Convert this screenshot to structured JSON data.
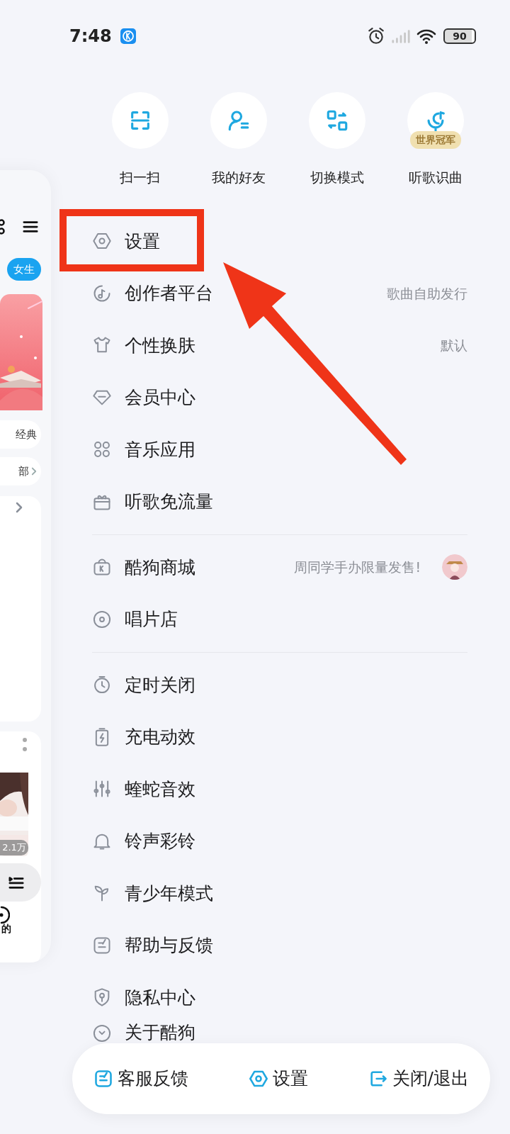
{
  "status_bar": {
    "time": "7:48",
    "battery": "90"
  },
  "quick_actions": [
    {
      "label": "扫一扫"
    },
    {
      "label": "我的好友"
    },
    {
      "label": "切换模式"
    },
    {
      "label": "听歌识曲",
      "badge": "世界冠军"
    }
  ],
  "menu_groups": [
    [
      {
        "label": "设置"
      },
      {
        "label": "创作者平台",
        "detail": "歌曲自助发行"
      },
      {
        "label": "个性换肤",
        "detail": "默认"
      },
      {
        "label": "会员中心"
      },
      {
        "label": "音乐应用"
      },
      {
        "label": "听歌免流量"
      }
    ],
    [
      {
        "label": "酷狗商城",
        "detail": "周同学手办限量发售!",
        "thumbnail": true
      },
      {
        "label": "唱片店"
      }
    ],
    [
      {
        "label": "定时关闭"
      },
      {
        "label": "充电动效"
      },
      {
        "label": "蝰蛇音效"
      },
      {
        "label": "铃声彩铃"
      },
      {
        "label": "青少年模式"
      },
      {
        "label": "帮助与反馈"
      },
      {
        "label": "隐私中心"
      },
      {
        "label": "关于酷狗"
      }
    ]
  ],
  "bottom_bar": [
    {
      "label": "客服反馈"
    },
    {
      "label": "设置"
    },
    {
      "label": "关闭/退出"
    }
  ],
  "background_panel": {
    "tab": "女生",
    "chips": [
      "经典",
      "部"
    ],
    "count_badge": "2.1万",
    "nav_label": "的"
  },
  "annotations": [
    {
      "kind": "box"
    },
    {
      "kind": "arrow"
    }
  ]
}
